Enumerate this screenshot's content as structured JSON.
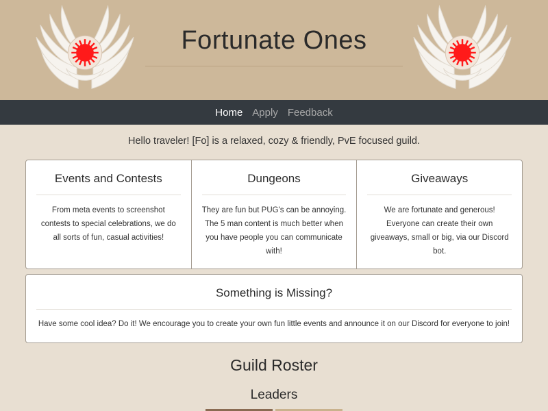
{
  "header": {
    "title": "Fortunate Ones",
    "emblem_icon": "winged-sun-emblem-icon",
    "colors": {
      "banner": "#cdb89a",
      "sun": "#ff1a1a",
      "wings": "#f6f3ee"
    }
  },
  "nav": {
    "items": [
      {
        "label": "Home",
        "active": true
      },
      {
        "label": "Apply",
        "active": false
      },
      {
        "label": "Feedback",
        "active": false
      }
    ]
  },
  "intro": "Hello traveler! [Fo] is a relaxed, cozy & friendly, PvE focused guild.",
  "cards": [
    {
      "title": "Events and Contests",
      "text": "From meta events to screenshot contests to special celebrations, we do all sorts of fun, casual activities!"
    },
    {
      "title": "Dungeons",
      "text": "They are fun but PUG's can be annoying. The 5 man content is much better when you have people you can communicate with!"
    },
    {
      "title": "Giveaways",
      "text": "We are fortunate and generous! Everyone can create their own giveaways, small or big, via our Discord bot."
    }
  ],
  "missing_card": {
    "title": "Something is Missing?",
    "text": "Have some cool idea? Do it! We encourage you to create your own fun little events and announce it on our Discord for everyone to join!"
  },
  "roster": {
    "title": "Guild Roster",
    "leaders_title": "Leaders"
  }
}
